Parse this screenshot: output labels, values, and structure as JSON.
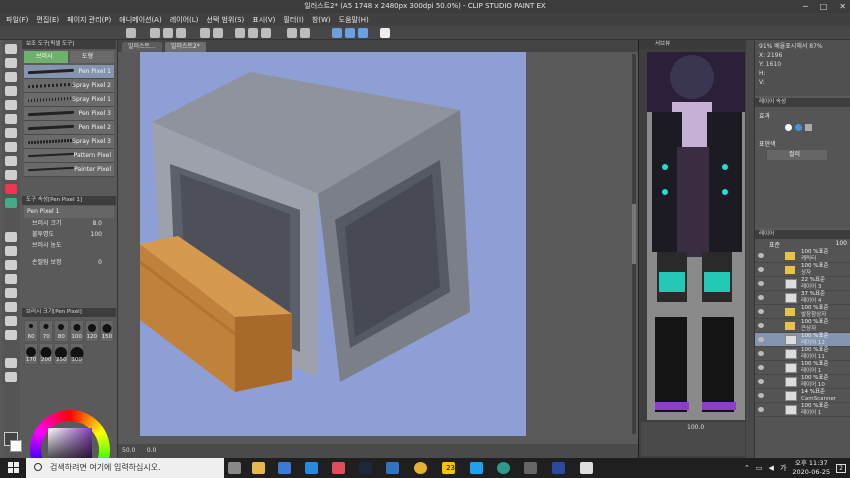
{
  "window": {
    "title": "일러스트2* (A5 1748 x 2480px 300dpi 50.0%) - CLIP STUDIO PAINT EX",
    "controls": [
      "─",
      "□",
      "✕"
    ]
  },
  "menu": [
    "파일(F)",
    "편집(E)",
    "페이지 관리(P)",
    "애니메이션(A)",
    "레이어(L)",
    "선택 범위(S)",
    "표시(V)",
    "필터(I)",
    "창(W)",
    "도움말(H)"
  ],
  "left": {
    "subtool_header": "보조 도구[픽셀 도구]",
    "subtool_tabs": [
      "브러시",
      "도형"
    ],
    "subtools": [
      {
        "label": "Pen Pixel 1",
        "selected": true
      },
      {
        "label": "Spray Pixel 2",
        "selected": false
      },
      {
        "label": "Spray Pixel 1",
        "selected": false
      },
      {
        "label": "Pen Pixel 3",
        "selected": false
      },
      {
        "label": "Pen Pixel 2",
        "selected": false
      },
      {
        "label": "Spray Pixel 3",
        "selected": false
      },
      {
        "label": "Pattern Pixel",
        "selected": false
      },
      {
        "label": "Painter Pixel",
        "selected": false
      }
    ],
    "tool_props_header": "도구 속성[Pen Pixel 1]",
    "tool_name": "Pen Pixel 1",
    "props": [
      {
        "label": "브러시 크기",
        "value": "8.0"
      },
      {
        "label": "불투명도",
        "value": "100"
      },
      {
        "label": "브러시 농도",
        "value": ""
      },
      {
        "label": "손떨림 보정",
        "value": "0"
      }
    ],
    "brush_size_header": "브러시 크기[Pen Pixel]",
    "brush_sizes": [
      "60",
      "70",
      "80",
      "100",
      "120",
      "150",
      "170",
      "200",
      "250",
      "300"
    ]
  },
  "doc": {
    "tabs": [
      {
        "label": "일러스트...",
        "active": false
      },
      {
        "label": "일러스트2*",
        "active": true
      }
    ],
    "status_zoom": "50.0",
    "status_coords": "0.0"
  },
  "navigator": {
    "header": "내비게이터",
    "zoom_value": "100.0"
  },
  "info": {
    "header": "서브뷰",
    "zoom_label": "91% 배율표시해서 87%",
    "x": "X: 2196",
    "y": "Y: 1610",
    "h": "H:",
    "v": "V:",
    "l": "L:"
  },
  "layer_props": {
    "header": "레이어 속성",
    "effect_label": "효과",
    "expression_label": "표현색",
    "color_value": "컬러"
  },
  "layers": {
    "header": "레이어",
    "blend_mode": "표준",
    "opacity": "100",
    "rows": [
      {
        "line1": "100 %표준",
        "line2": "캐릭터",
        "type": "folder",
        "selected": false
      },
      {
        "line1": "100 %표준",
        "line2": "상자",
        "type": "folder",
        "selected": false
      },
      {
        "line1": "22 %표준",
        "line2": "레이어 3",
        "type": "layer",
        "selected": false
      },
      {
        "line1": "37 %표준",
        "line2": "레이어 4",
        "type": "layer",
        "selected": false
      },
      {
        "line1": "100 %표준",
        "line2": "발장참상자",
        "type": "folder",
        "selected": false
      },
      {
        "line1": "100 %표준",
        "line2": "큰상자",
        "type": "folder",
        "selected": false
      },
      {
        "line1": "100 %표준",
        "line2": "레이어 12",
        "type": "layer",
        "selected": true
      },
      {
        "line1": "100 %표준",
        "line2": "레이어 11",
        "type": "layer",
        "selected": false
      },
      {
        "line1": "100 %표준",
        "line2": "레이어 1",
        "type": "layer",
        "selected": false
      },
      {
        "line1": "100 %표준",
        "line2": "레이어 10",
        "type": "layer",
        "selected": false
      },
      {
        "line1": "14 %표준",
        "line2": "CamScanner",
        "type": "layer",
        "selected": false
      },
      {
        "line1": "100 %표준",
        "line2": "레이어 1",
        "type": "layer",
        "selected": false
      }
    ]
  },
  "taskbar": {
    "search_placeholder": "검색하려면 여기에 입력하십시오.",
    "badge": "23",
    "time": "오후 11:37",
    "date": "2020-06-25",
    "notif": "2",
    "lang": "가"
  },
  "colors": {
    "canvas_bg": "#8e9fd6",
    "cube_light": "#a4a8b2",
    "cube_dark": "#6f747e",
    "wood": "#c0823a",
    "accent_select": "#8595b0"
  }
}
